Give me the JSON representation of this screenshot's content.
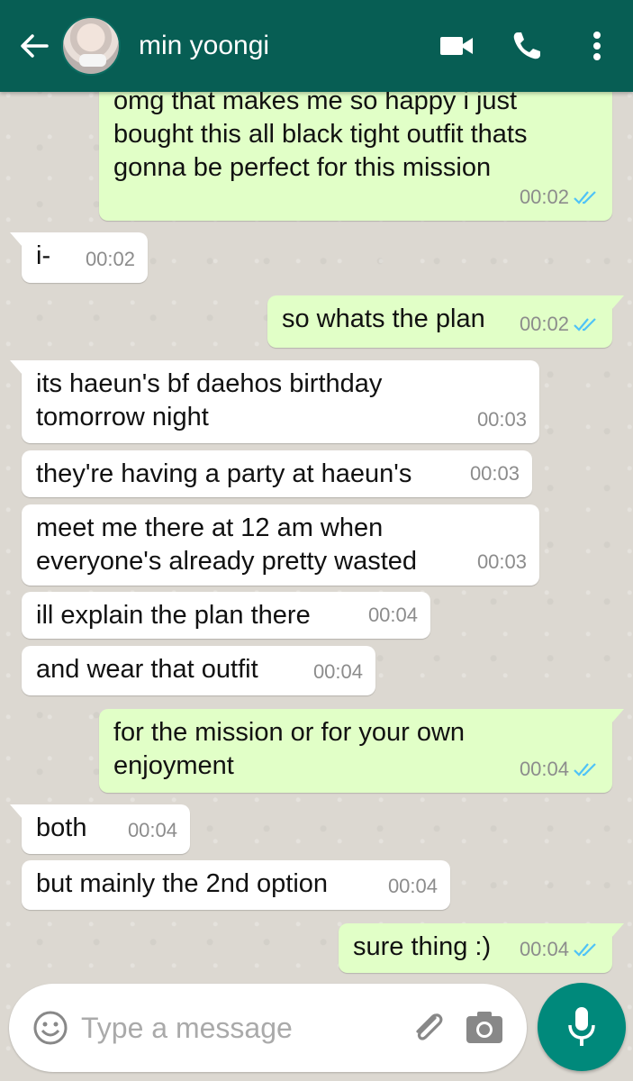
{
  "header": {
    "contact_name": "min yoongi",
    "icons": [
      "back-arrow-icon",
      "video-call-icon",
      "phone-icon",
      "more-options-icon"
    ]
  },
  "messages": [
    {
      "direction": "out",
      "text": "omg that makes me so happy i just bought this all black tight outfit thats gonna be perfect for this mission",
      "time": "00:02",
      "read": true
    },
    {
      "direction": "in",
      "text": "i-",
      "time": "00:02"
    },
    {
      "direction": "out",
      "text": "so whats the plan",
      "time": "00:02",
      "read": true
    },
    {
      "direction": "in",
      "text": "its haeun's bf daehos birthday tomorrow night",
      "time": "00:03"
    },
    {
      "direction": "in",
      "text": "they're having a party at haeun's",
      "time": "00:03"
    },
    {
      "direction": "in",
      "text": "meet me there at 12 am when everyone's already pretty wasted",
      "time": "00:03"
    },
    {
      "direction": "in",
      "text": "ill explain the plan there",
      "time": "00:04"
    },
    {
      "direction": "in",
      "text": "and wear that outfit",
      "time": "00:04"
    },
    {
      "direction": "out",
      "text": "for the mission or for your own enjoyment",
      "time": "00:04",
      "read": true
    },
    {
      "direction": "in",
      "text": "both",
      "time": "00:04"
    },
    {
      "direction": "in",
      "text": "but mainly the 2nd option",
      "time": "00:04"
    },
    {
      "direction": "out",
      "text": "sure thing :)",
      "time": "00:04",
      "read": true
    }
  ],
  "composer": {
    "placeholder": "Type a message",
    "icons": [
      "emoji-icon",
      "attach-icon",
      "camera-icon",
      "mic-icon"
    ]
  },
  "colors": {
    "header": "#075e54",
    "outgoing_bubble": "#e1ffc7",
    "incoming_bubble": "#ffffff",
    "read_ticks": "#4fc3f7",
    "mic_button": "#00897b"
  }
}
